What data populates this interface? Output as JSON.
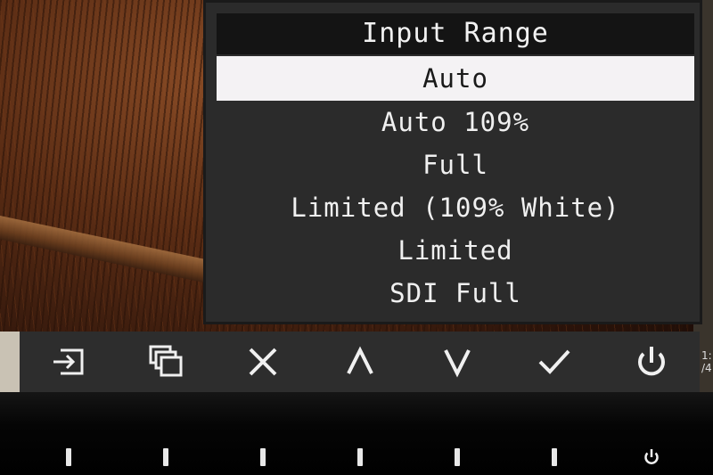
{
  "menu": {
    "title": "Input Range",
    "items": [
      {
        "label": "Auto",
        "selected": true
      },
      {
        "label": "Auto 109%",
        "selected": false
      },
      {
        "label": "Full",
        "selected": false
      },
      {
        "label": "Limited (109% White)",
        "selected": false
      },
      {
        "label": "Limited",
        "selected": false
      },
      {
        "label": "SDI Full",
        "selected": false
      }
    ]
  },
  "guide_buttons": [
    {
      "icon": "input-select-icon"
    },
    {
      "icon": "picture-in-picture-icon"
    },
    {
      "icon": "close-icon"
    },
    {
      "icon": "up-arrow-icon"
    },
    {
      "icon": "down-arrow-icon"
    },
    {
      "icon": "checkmark-icon"
    },
    {
      "icon": "power-icon"
    }
  ],
  "edge_text": {
    "line1": "1:",
    "line2": "/4"
  },
  "colors": {
    "menu_bg": "#2b2b2b",
    "title_bg": "#141414",
    "selected_bg": "#f4f2f4",
    "text": "#f0f0f0"
  }
}
